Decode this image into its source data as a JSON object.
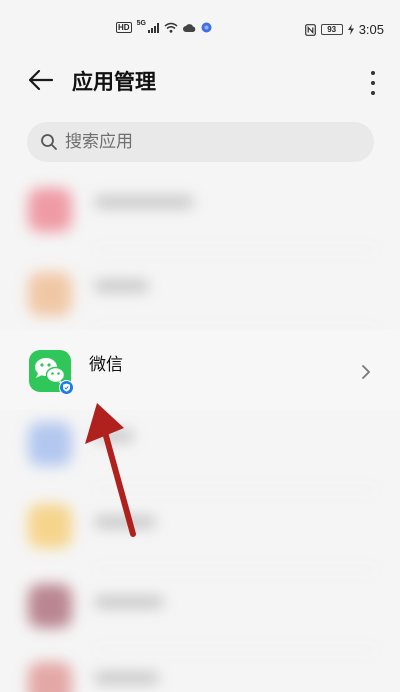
{
  "status_bar": {
    "hd": "HD",
    "network": "5G",
    "battery": "93",
    "time": "3:05"
  },
  "header": {
    "title": "应用管理",
    "back_icon": "arrow-left-icon",
    "more_icon": "more-vertical-icon"
  },
  "search": {
    "placeholder": "搜索应用",
    "icon": "search-icon"
  },
  "app_list": {
    "highlighted_app": {
      "name": "微信",
      "icon": "wechat-icon",
      "badge_icon": "shield-verified-icon",
      "chevron_icon": "chevron-right-icon"
    },
    "blurred_icon_colors": [
      "#ee8c98",
      "#f0c098",
      "#a8c0ee",
      "#f6cf7a",
      "#b07480",
      "#e09a98"
    ]
  },
  "colors": {
    "wechat_green": "#2fc65a",
    "badge_blue": "#1e7ae6",
    "annotation_arrow": "#b0211e",
    "search_bg": "#e9e9e9",
    "page_bg": "#f5f5f5"
  }
}
